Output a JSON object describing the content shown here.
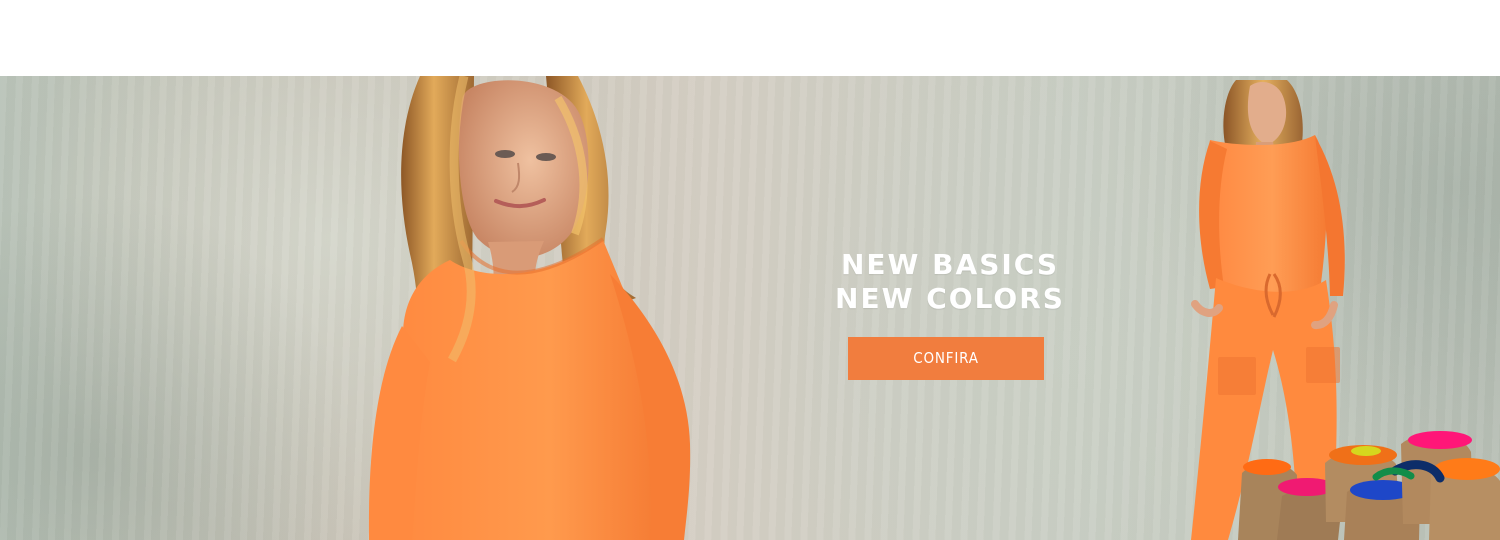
{
  "promo": {
    "headline_line_1": "NEW BASICS",
    "headline_line_2": "NEW COLORS",
    "cta_label": "CONFIRA"
  },
  "colors": {
    "accent": "#f17d3e",
    "background": "#ffffff",
    "text": "#ffffff"
  },
  "images": {
    "left_model": "woman-in-orange-top",
    "right_model": "woman-in-orange-loungewear",
    "props": "colored-powder-bags"
  }
}
